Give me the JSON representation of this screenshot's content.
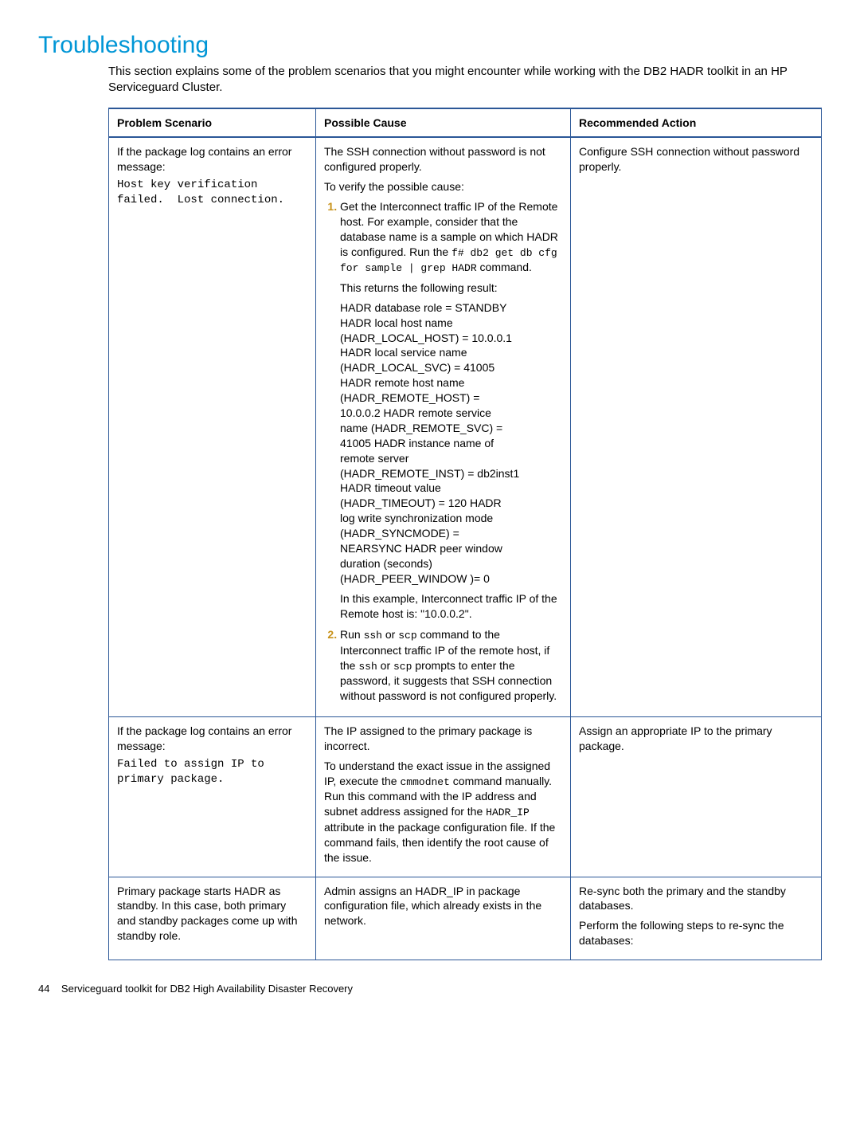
{
  "page_heading": "Troubleshooting",
  "intro": "This section explains some of the problem scenarios that you might encounter while working with the DB2 HADR toolkit in an HP Serviceguard Cluster.",
  "table": {
    "headers": [
      "Problem Scenario",
      "Possible Cause",
      "Recommended Action"
    ],
    "rows": [
      {
        "scenario_text": "If the package log contains an error message:",
        "scenario_code": "Host key verification failed.  Lost connection.",
        "cause": {
          "lead": "The SSH connection without password is not configured properly.",
          "verify_heading": "To verify the possible cause:",
          "step1_text": "Get the Interconnect traffic IP of the Remote host. For example, consider that the database name is a sample on which HADR is configured. Run the ",
          "step1_cmd": "f# db2 get db cfg for sample | grep HADR",
          "step1_cmd_suffix": " command.",
          "returns_line": "This returns the following result:",
          "hadr_output": "HADR database role = STANDBY\nHADR local host name\n(HADR_LOCAL_HOST) = 10.0.0.1\nHADR local service name\n(HADR_LOCAL_SVC) = 41005\nHADR remote host name\n(HADR_REMOTE_HOST) =\n10.0.0.2 HADR remote service\nname (HADR_REMOTE_SVC) =\n41005 HADR instance name of\nremote server\n(HADR_REMOTE_INST) = db2inst1\nHADR timeout value\n(HADR_TIMEOUT) =  120 HADR\nlog write synchronization mode\n(HADR_SYNCMODE) =\nNEARSYNC HADR peer window\nduration (seconds)\n(HADR_PEER_WINDOW )= 0",
          "example_line": "In this example, Interconnect traffic IP of the Remote host is: \"10.0.0.2\".",
          "step2_pre": "Run ",
          "step2_cmd1": "ssh",
          "step2_mid1": " or ",
          "step2_cmd2": "scp",
          "step2_mid2": " command to the Interconnect traffic IP of the remote host, if the ",
          "step2_cmd3": "ssh",
          "step2_mid3": " or ",
          "step2_cmd4": "scp",
          "step2_tail": " prompts to enter the password, it suggests that SSH connection without password is not configured properly."
        },
        "action": "Configure SSH connection without password properly."
      },
      {
        "scenario_text": "If the package log contains an error message:",
        "scenario_code": "Failed to assign IP to primary package.",
        "cause": {
          "lead": "The IP assigned to the primary package is incorrect.",
          "body_pre": "To understand the exact issue in the assigned IP, execute the ",
          "cmd1": "cmmodnet",
          "body_mid": " command manually. Run this command with the IP address and subnet address assigned for the ",
          "cmd2": "HADR_IP",
          "body_tail": " attribute in the package configuration file. If the command fails, then identify the root cause of the issue."
        },
        "action": "Assign an appropriate IP to the primary package."
      },
      {
        "scenario_text": "Primary package starts HADR as standby. In this case, both primary and standby packages come up with standby role.",
        "cause_text": "Admin assigns an HADR_IP in package configuration file, which already exists in the network.",
        "action_line1": "Re-sync both the primary and the standby databases.",
        "action_line2": "Perform the following steps to re-sync the databases:"
      }
    ]
  },
  "footer": {
    "page_num": "44",
    "running_title": "Serviceguard toolkit for DB2 High Availability Disaster Recovery"
  }
}
